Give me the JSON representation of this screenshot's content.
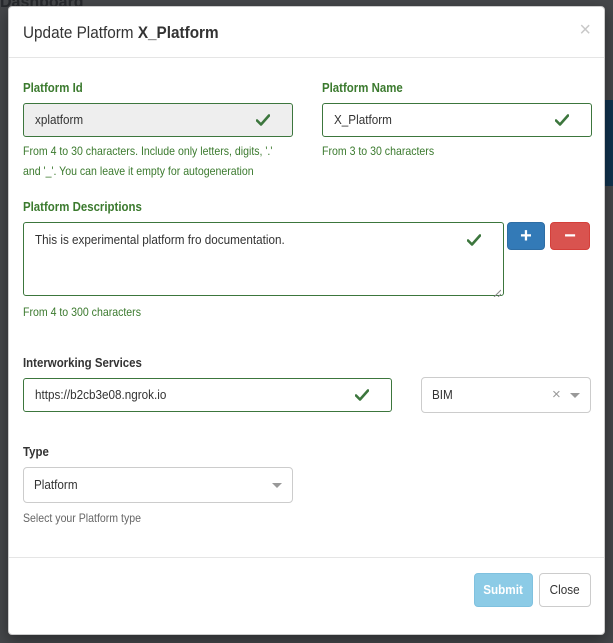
{
  "background": {
    "title": "Dashboard"
  },
  "modal": {
    "title_prefix": "Update Platform",
    "title_name": "X_Platform",
    "close_glyph": "×"
  },
  "platform_id": {
    "label": "Platform Id",
    "value": "xplatform",
    "help_line1": "From 4 to 30 characters. Include only letters, digits, '.'",
    "help_line2": "and '_'. You can leave it empty for autogeneration"
  },
  "platform_name": {
    "label": "Platform Name",
    "value": "X_Platform",
    "help": "From 3 to 30 characters"
  },
  "descriptions": {
    "label": "Platform Descriptions",
    "value": "This is experimental platform fro documentation.",
    "help": "From 4 to 300 characters",
    "add_glyph": "+",
    "remove_glyph": "−"
  },
  "interworking": {
    "label": "Interworking Services",
    "url_value": "https://b2cb3e08.ngrok.io",
    "select_value": "BIM",
    "clear_glyph": "×"
  },
  "type": {
    "label": "Type",
    "value": "Platform",
    "help": "Select your Platform type"
  },
  "footer": {
    "submit_label": "Submit",
    "close_label": "Close"
  },
  "colors": {
    "valid_green": "#3c763d",
    "primary_blue": "#337ab7",
    "danger_red": "#d9534f",
    "submit_disabled": "#8ccbe6"
  },
  "icons": [
    "checkmark-icon",
    "plus-icon",
    "minus-icon",
    "close-icon",
    "caret-down-icon"
  ]
}
